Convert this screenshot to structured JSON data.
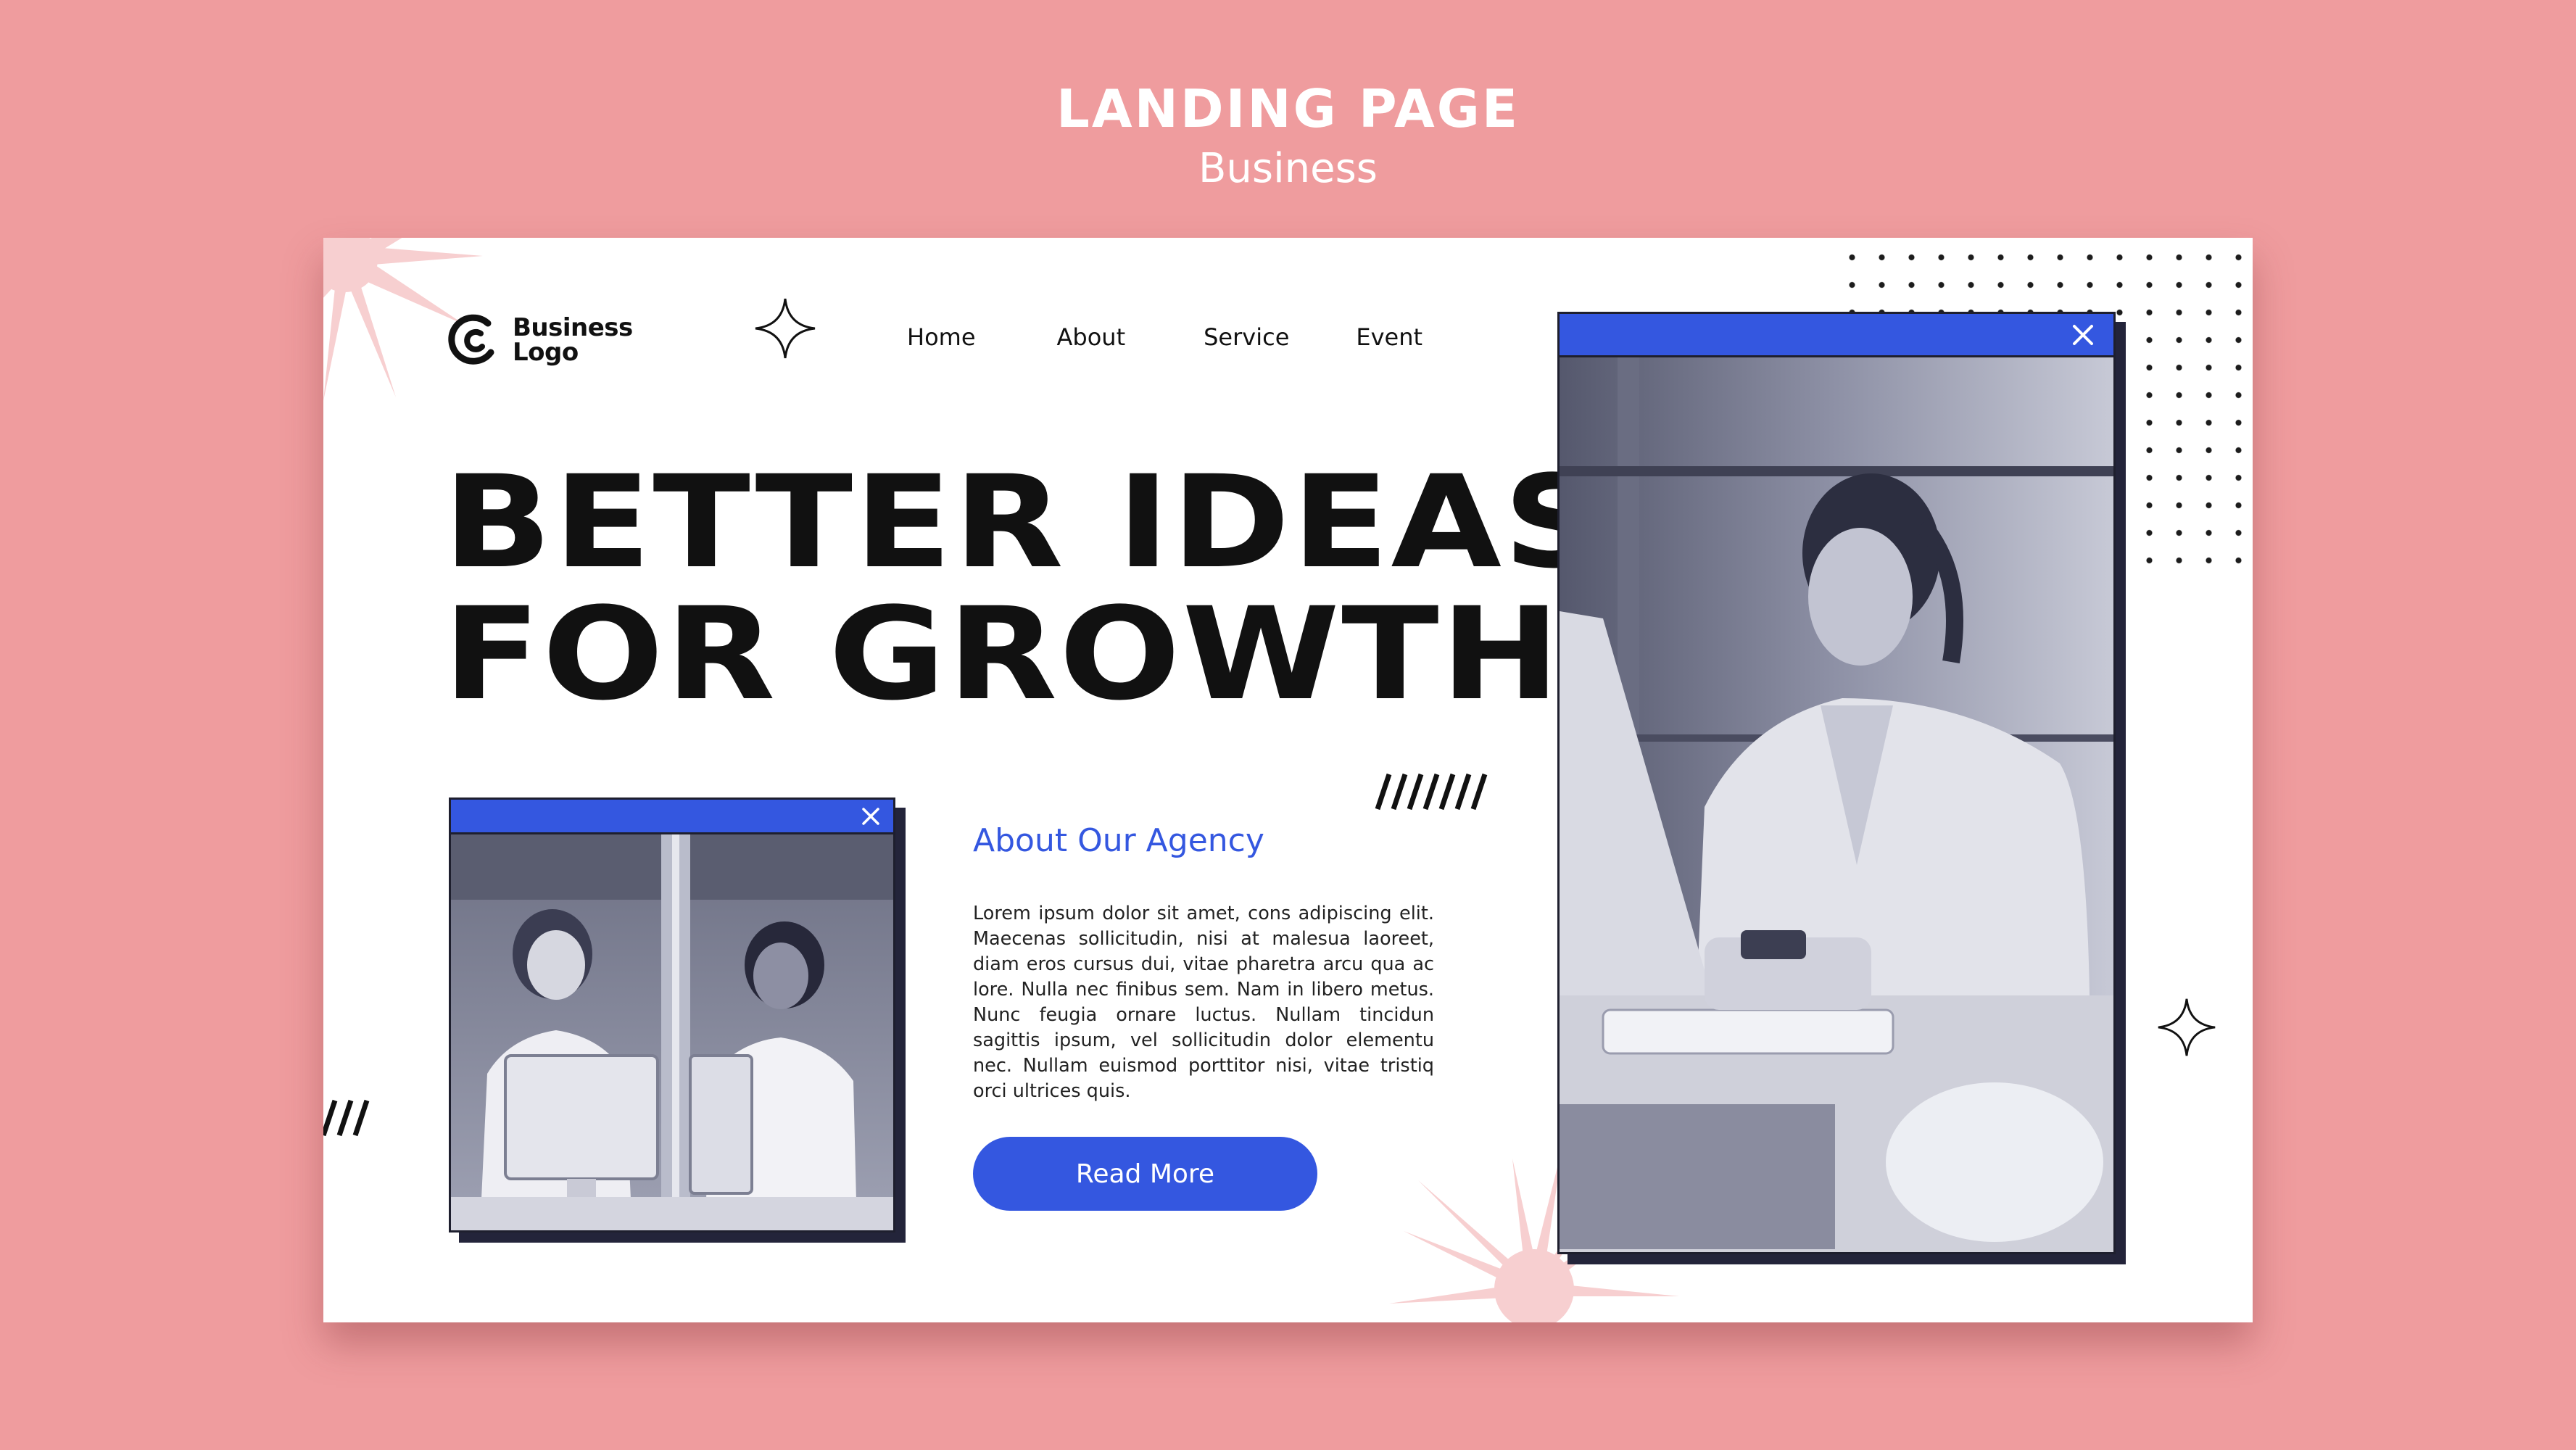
{
  "header": {
    "title": "LANDING PAGE",
    "subtitle": "Business"
  },
  "logo": {
    "icon": "c-logo-icon",
    "line1": "Business",
    "line2": "Logo"
  },
  "nav": {
    "items": [
      {
        "label": "Home"
      },
      {
        "label": "About"
      },
      {
        "label": "Service"
      },
      {
        "label": "Event"
      }
    ]
  },
  "hero": {
    "line1": "BETTER IDEAS",
    "line2": "FOR GROWTH"
  },
  "about": {
    "title": "About Our Agency",
    "body": "Lorem ipsum dolor sit amet, cons adipiscing elit. Maecenas sollicitudin, nisi at malesua laoreet, diam eros cursus dui, vitae pharetra arcu qua ac lore. Nulla nec finibus sem. Nam in libero metus. Nunc feugia ornare luctus. Nullam tincidun sagittis ipsum, vel sollicitudin dolor elementu nec. Nullam euismod porttitor nisi, vitae tristiq orci ultrices quis.",
    "button_label": "Read More"
  },
  "icons": {
    "close": "close-icon",
    "sparkle": "sparkle-icon",
    "burst": "burst-icon"
  },
  "colors": {
    "background": "#ef9c9e",
    "accent": "#3457e0",
    "dark": "#111111",
    "burst": "#f7cfd0"
  }
}
